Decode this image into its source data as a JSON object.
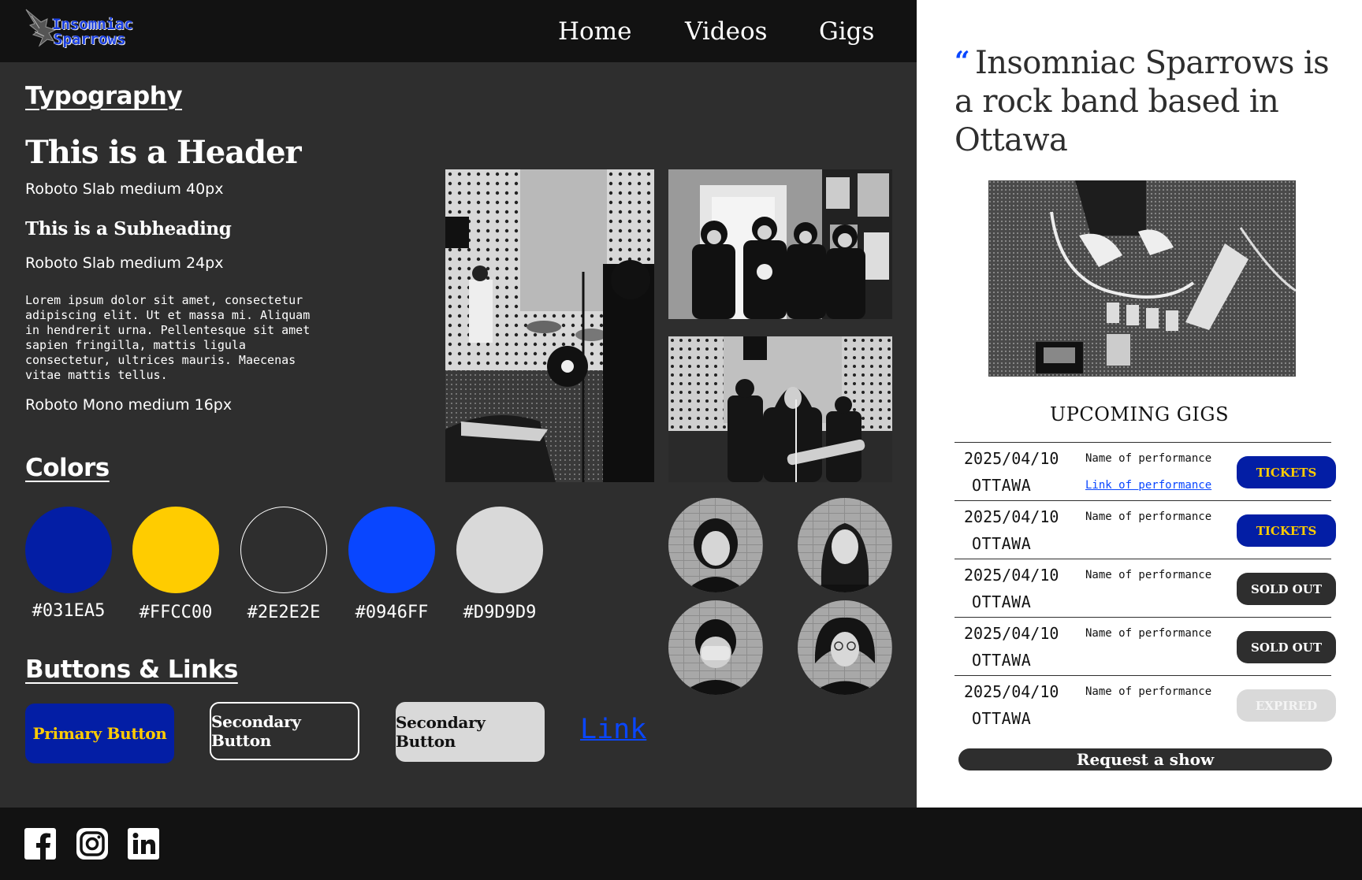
{
  "brand": {
    "line1": "Insomniac",
    "line2": "Sparrows"
  },
  "nav": {
    "home": "Home",
    "videos": "Videos",
    "gigs": "Gigs"
  },
  "typography": {
    "section_title": "Typography",
    "header_sample": "This is a Header",
    "header_spec": "Roboto Slab medium 40px",
    "subheading_sample": "This is a Subheading",
    "subheading_spec": "Roboto Slab medium 24px",
    "body_sample": "Lorem ipsum dolor sit amet, consectetur adipiscing elit. Ut et massa mi. Aliquam in hendrerit urna. Pellentesque sit amet sapien fringilla, mattis ligula consectetur, ultrices mauris. Maecenas vitae mattis tellus.",
    "body_spec": "Roboto Mono medium 16px"
  },
  "colors": {
    "section_title": "Colors",
    "swatches": [
      {
        "hex": "#031EA5",
        "color": "#031EA5"
      },
      {
        "hex": "#FFCC00",
        "color": "#FFCC00"
      },
      {
        "hex": "#2E2E2E",
        "color": "#2E2E2E"
      },
      {
        "hex": "#0946FF",
        "color": "#0946FF"
      },
      {
        "hex": "#D9D9D9",
        "color": "#D9D9D9"
      }
    ]
  },
  "buttons": {
    "section_title": "Buttons & Links",
    "primary": "Primary Button",
    "secondary_outline": "Secondary Button",
    "secondary_light": "Secondary Button",
    "link": "Link"
  },
  "hero": {
    "quote_mark": "“",
    "quote": "Insomniac Sparrows is a rock band based in Ottawa"
  },
  "gigs": {
    "title": "UPCOMING GIGS",
    "rows": [
      {
        "date": "2025/04/10",
        "city": "OTTAWA",
        "name": "Name of performance",
        "link": "Link of performance",
        "status": "TICKETS"
      },
      {
        "date": "2025/04/10",
        "city": "OTTAWA",
        "name": "Name of performance",
        "link": "",
        "status": "TICKETS"
      },
      {
        "date": "2025/04/10",
        "city": "OTTAWA",
        "name": "Name of performance",
        "link": "",
        "status": "SOLD OUT"
      },
      {
        "date": "2025/04/10",
        "city": "OTTAWA",
        "name": "Name of performance",
        "link": "",
        "status": "SOLD OUT"
      },
      {
        "date": "2025/04/10",
        "city": "OTTAWA",
        "name": "Name of performance",
        "link": "",
        "status": "EXPIRED"
      }
    ],
    "request": "Request a show"
  },
  "social": [
    "facebook-icon",
    "instagram-icon",
    "linkedin-icon"
  ],
  "theme": {
    "dark": "#2E2E2E",
    "black": "#121212",
    "primary": "#031EA5",
    "accent": "#FFCC00",
    "link": "#0946FF",
    "light": "#D9D9D9"
  }
}
